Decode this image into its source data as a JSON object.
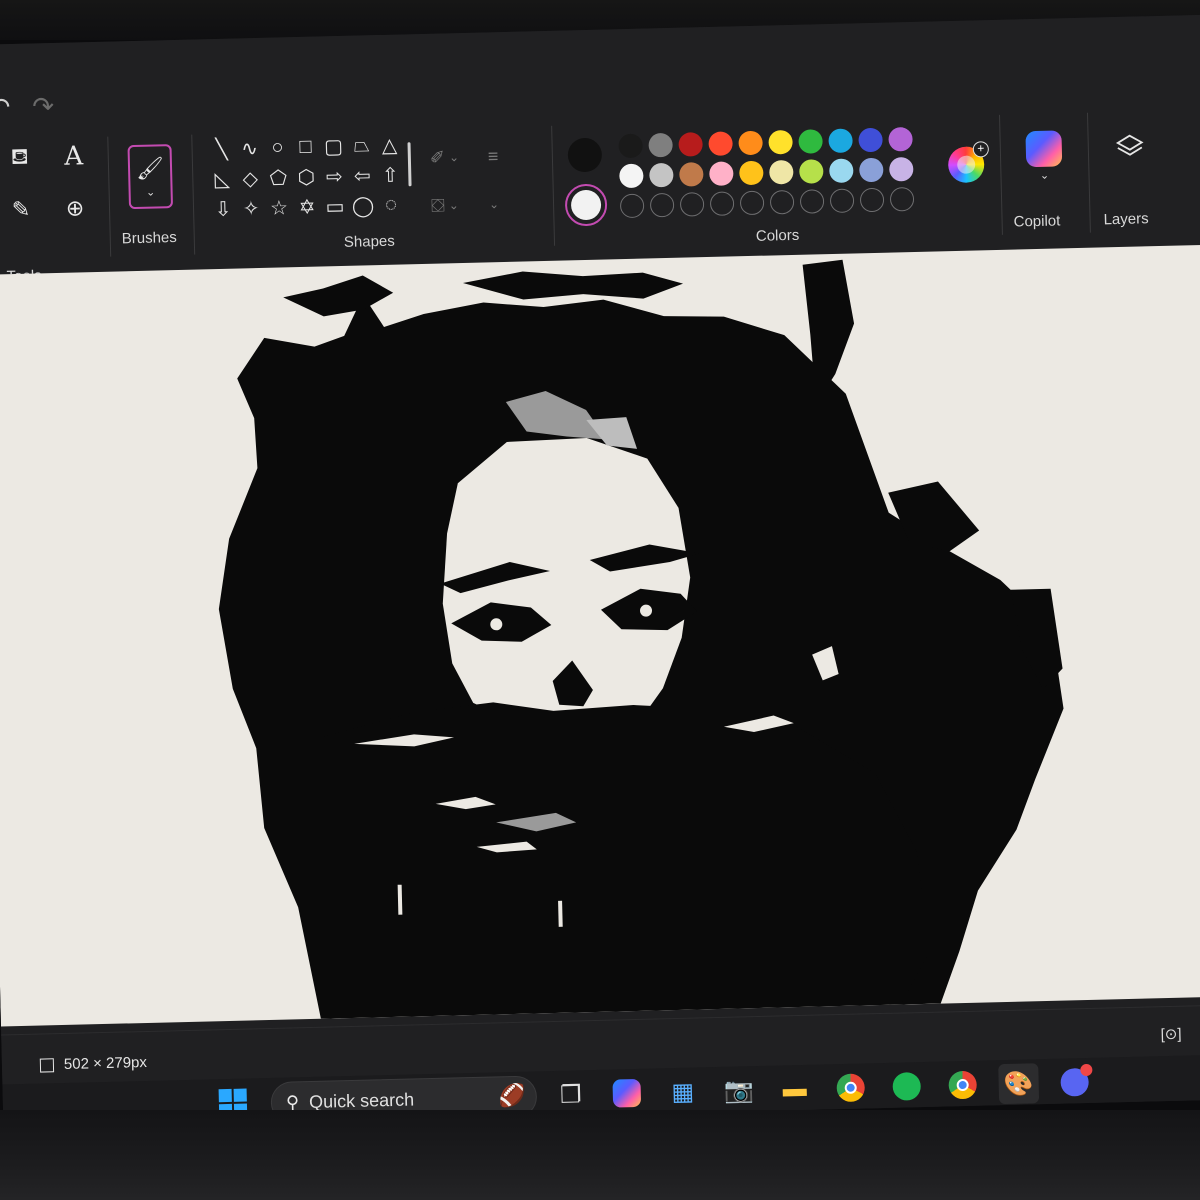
{
  "ribbon": {
    "groups": {
      "tools": "Tools",
      "brushes": "Brushes",
      "shapes": "Shapes",
      "colors": "Colors",
      "copilot": "Copilot",
      "layers": "Layers"
    },
    "tools": [
      {
        "name": "fill",
        "glyph": "🪣"
      },
      {
        "name": "text",
        "glyph": "A"
      },
      {
        "name": "color-picker",
        "glyph": "✎"
      },
      {
        "name": "magnifier",
        "glyph": "⊕"
      }
    ],
    "shapes": [
      "╲",
      "∿",
      "○",
      "□",
      "▢",
      "⏢",
      "△",
      "◺",
      "◇",
      "⬠",
      "⬡",
      "⇨",
      "⇦",
      "⇧",
      "⇩",
      "✧",
      "☆",
      "✡",
      "▭",
      "◯",
      "◌"
    ],
    "colors": {
      "primary": "#111111",
      "secondary": "#f2f2f2",
      "accent": "#c34bb1",
      "row1": [
        "#1a1a1a",
        "#7f7f7f",
        "#b71c1c",
        "#ff4a2e",
        "#ff8c1a",
        "#ffe12b",
        "#2fba3f",
        "#1ba8e0",
        "#3f4fd8",
        "#b364d6"
      ],
      "row2": [
        "#f4f4f4",
        "#c4c4c4",
        "#c07a4a",
        "#ffb1c8",
        "#ffc21a",
        "#efe6a6",
        "#b6e04a",
        "#9ad8ef",
        "#8aa0d8",
        "#c8b3e6"
      ],
      "empty_slots": 10
    }
  },
  "status": {
    "canvas_size": "502 × 279px"
  },
  "taskbar": {
    "search_placeholder": "Quick search",
    "apps": [
      "start",
      "search",
      "task-view",
      "copilot",
      "store",
      "camera",
      "file-explorer",
      "chrome",
      "spotify",
      "chrome-profile",
      "paint",
      "discord"
    ]
  }
}
